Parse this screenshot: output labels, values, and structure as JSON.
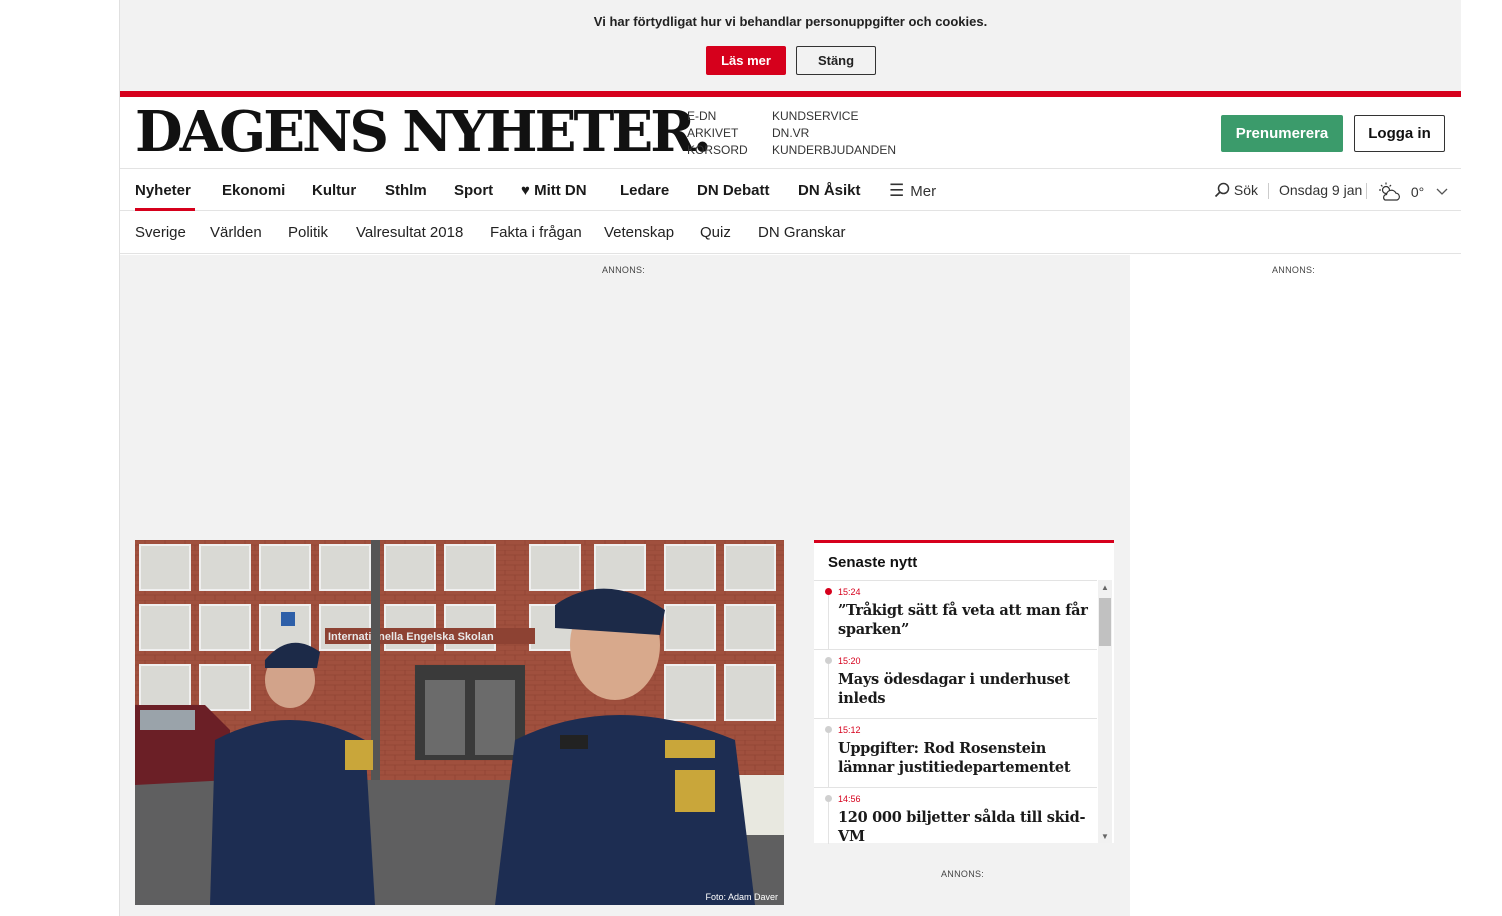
{
  "cookie": {
    "text": "Vi har förtydligat hur vi behandlar personuppgifter och cookies.",
    "read_more": "Läs mer",
    "close": "Stäng"
  },
  "header": {
    "logo": "DAGENS NYHETER.",
    "links_col1": [
      "E-DN",
      "Arkivet",
      "Korsord"
    ],
    "links_col2": [
      "Kundservice",
      "DN.VR",
      "Kunderbjudanden"
    ],
    "subscribe": "Prenumerera",
    "login": "Logga in"
  },
  "nav": {
    "items": [
      "Nyheter",
      "Ekonomi",
      "Kultur",
      "Sthlm",
      "Sport",
      "Mitt DN",
      "Ledare",
      "DN Debatt",
      "DN Åsikt"
    ],
    "more": "Mer",
    "search": "Sök",
    "date": "Onsdag 9 jan",
    "temperature": "0°",
    "accent": "#d6001c"
  },
  "subnav": {
    "items": [
      "Sverige",
      "Världen",
      "Politik",
      "Valresultat 2018",
      "Fakta i frågan",
      "Vetenskap",
      "Quiz",
      "DN Granskar"
    ]
  },
  "ads": {
    "label": "ANNONS:"
  },
  "hero": {
    "credit": "Foto: Adam Daver",
    "sign_text": "Internationella Engelska Skolan"
  },
  "latest": {
    "title": "Senaste nytt",
    "items": [
      {
        "time": "15:24",
        "headline": "”Tråkigt sätt få veta att man får sparken”"
      },
      {
        "time": "15:20",
        "headline": "Mays ödesdagar i underhuset inleds"
      },
      {
        "time": "15:12",
        "headline": "Uppgifter: Rod Rosenstein lämnar justitiedepartementet"
      },
      {
        "time": "14:56",
        "headline": "120 000 biljetter sålda till skid-VM"
      }
    ]
  }
}
